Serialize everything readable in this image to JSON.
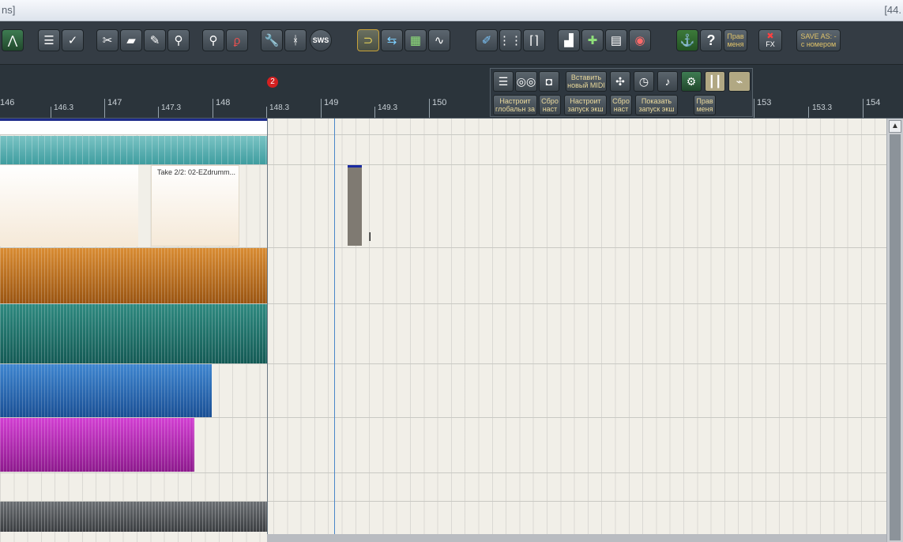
{
  "titlebar": {
    "left_text": "ns]",
    "right_text": "[44."
  },
  "toolbar": {
    "icons": [
      "envelope-icon",
      "track-visibility-icon",
      "eye-check-icon",
      "scissors-icon",
      "eraser-icon",
      "pencil-icon",
      "zoom-icon",
      "search-icon",
      "lasso-icon",
      "wrench-icon",
      "walkers-icon",
      "sws-icon",
      "loop-icon",
      "ripple-icon",
      "snapshot-icon",
      "waveform-icon",
      "midi-edit-icon",
      "grid-icon",
      "brackets-icon",
      "brush-icon",
      "new-track-icon",
      "table-icon",
      "record-icon",
      "anchor-icon",
      "help-icon"
    ],
    "sws_label": "SWS",
    "help_label": "?",
    "prav_label_1": "Прав",
    "prav_label_2": "меня",
    "fx_label": "FX",
    "save_as_line1": "SAVE AS: -",
    "save_as_line2": "с номером"
  },
  "ruler": {
    "labels": [
      "146",
      "146.3",
      "147",
      "147.3",
      "148",
      "148.3",
      "149",
      "149.3",
      "150",
      "153",
      "153.3",
      "154"
    ],
    "marker_number": "2"
  },
  "floating_toolbar": {
    "insert_midi_line1": "Вставить",
    "insert_midi_line2": "новый MIDI",
    "b1": "Настроит\nглобальн за",
    "b2": "Сбро\nнаст",
    "b3": "Настроит\nзапуск экш",
    "b4": "Сбро\nнаст",
    "b5": "Показать\nзапуск экш",
    "b6": "Прав\nменя"
  },
  "arrange": {
    "take_label": "Take 2/2: 02-EZdrumm..."
  },
  "colors": {
    "toolbar_bg": "#343c44",
    "teal_light": "#5fb3b4",
    "orange": "#c67a22",
    "teal_dark": "#23776f",
    "blue": "#2d73c0",
    "magenta": "#bb2dbb",
    "gray": "#55585c"
  }
}
